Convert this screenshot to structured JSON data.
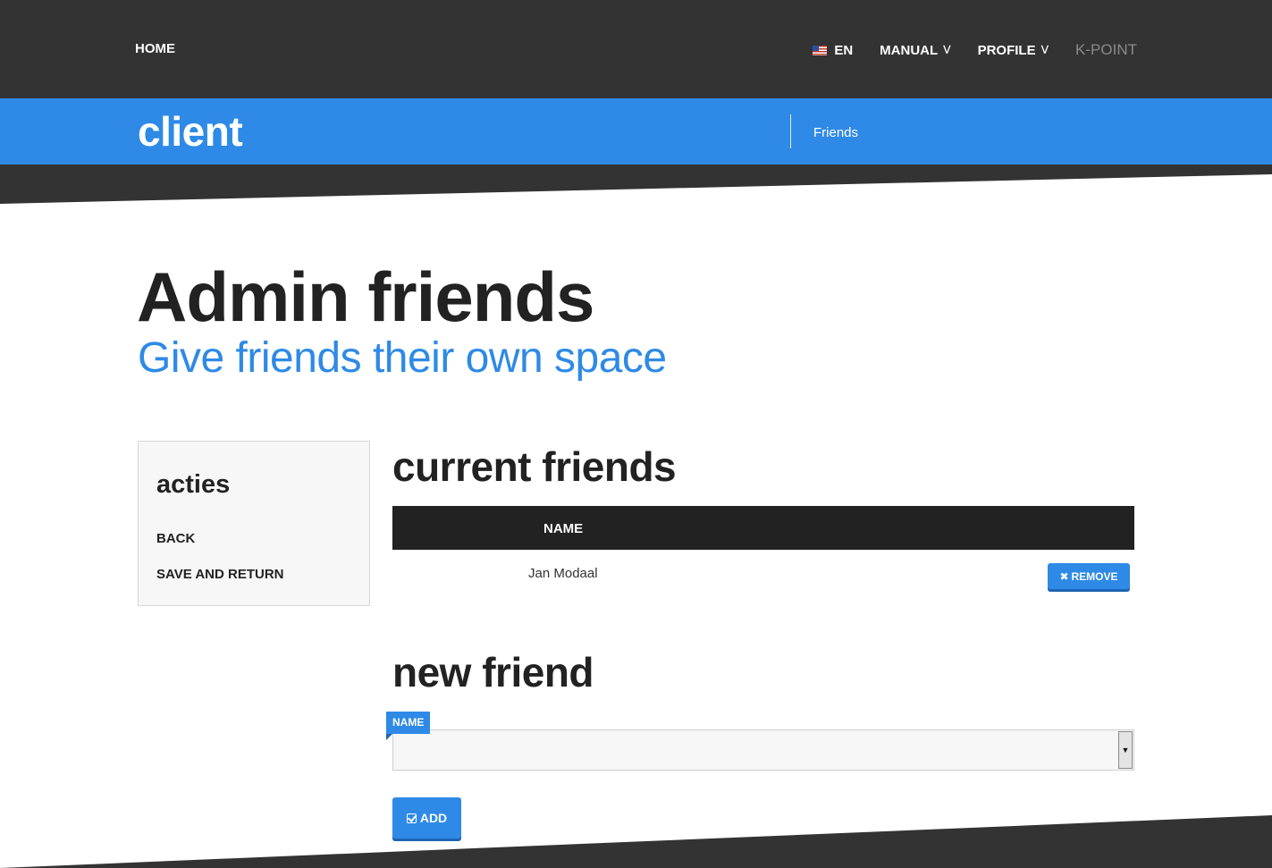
{
  "topnav": {
    "home_label": "HOME",
    "language_label": "EN",
    "manual_label": "MANUAL",
    "profile_label": "PROFILE",
    "kpoint_label": "K-POINT"
  },
  "subheader": {
    "brand": "client",
    "link_label": "Friends"
  },
  "page": {
    "title": "Admin friends",
    "subtitle": "Give friends their own space"
  },
  "sidebar": {
    "title": "acties",
    "items": [
      {
        "label": "BACK"
      },
      {
        "label": "SAVE AND RETURN"
      }
    ]
  },
  "current_friends": {
    "heading": "current friends",
    "column_name": "NAME",
    "rows": [
      {
        "name": "Jan Modaal",
        "action_label": "REMOVE"
      }
    ]
  },
  "new_friend": {
    "heading": "new friend",
    "field_label": "NAME",
    "selected_value": "",
    "add_label": "ADD"
  },
  "colors": {
    "accent": "#2e8ae6",
    "dark": "#333333",
    "table_header": "#222222"
  }
}
